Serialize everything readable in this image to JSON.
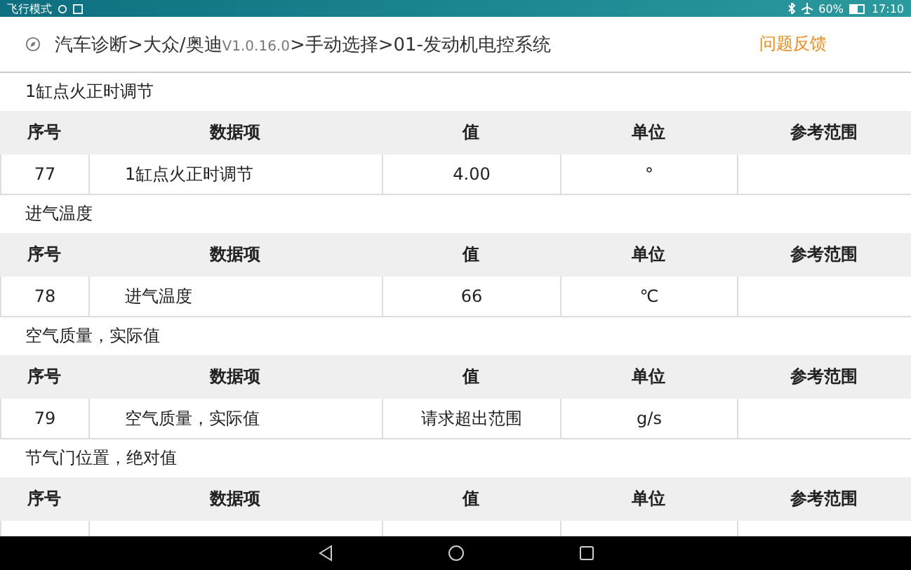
{
  "status_bar": {
    "left": "飞行模式",
    "battery": "60%",
    "time": "17:10"
  },
  "header": {
    "path": "汽车诊断>大众/奥迪",
    "version": "V1.0.16.0",
    "path_rest": ">手动选择>01-发动机电控系统",
    "feedback": "问题反馈"
  },
  "sections": [
    {
      "title": "1缸点火正时调节",
      "columns": [
        "序号",
        "数据项",
        "值",
        "单位",
        "参考范围"
      ],
      "row": {
        "no": "77",
        "item": "1缸点火正时调节",
        "value": "4.00",
        "unit": "°"
      }
    },
    {
      "title": "进气温度",
      "columns": [
        "序号",
        "数据项",
        "值",
        "单位",
        "参考范围"
      ],
      "row": {
        "no": "78",
        "item": "进气温度",
        "value": "66",
        "unit": "℃"
      }
    },
    {
      "title": "空气质量，实际值",
      "columns": [
        "序号",
        "数据项",
        "值",
        "单位",
        "参考范围"
      ],
      "row": {
        "no": "79",
        "item": "空气质量，实际值",
        "value": "请求超出范围",
        "unit": "g/s"
      }
    },
    {
      "title": "节气门位置，绝对值",
      "columns": [
        "序号",
        "数据项",
        "值",
        "单位",
        "参考范围"
      ]
    }
  ]
}
